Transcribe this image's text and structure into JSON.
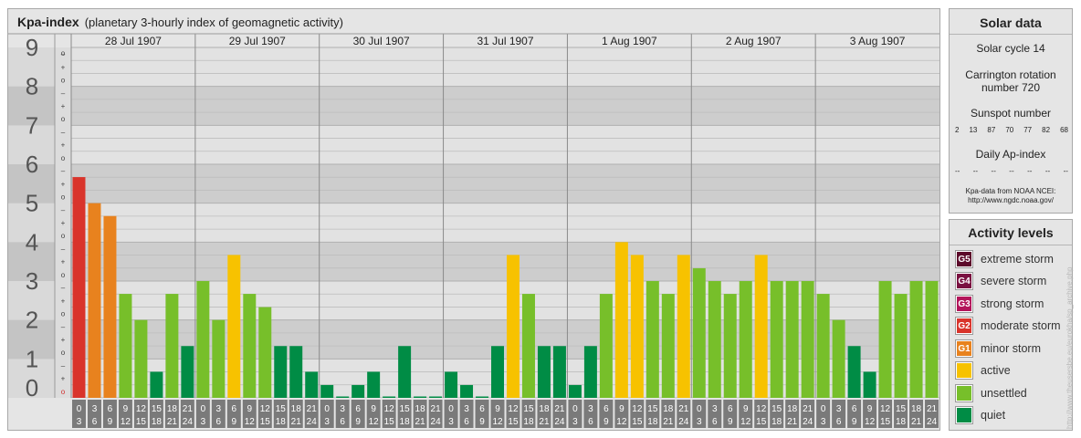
{
  "header": {
    "title": "Kpa-index",
    "subtitle": "(planetary 3-hourly index of geomagnetic activity)"
  },
  "chart_data": {
    "type": "bar",
    "title": "Kpa-index",
    "subtitle": "(planetary 3-hourly index of geomagnetic activity)",
    "ylim": [
      0,
      9
    ],
    "y_ticks": [
      "0",
      "1",
      "2",
      "3",
      "4",
      "5",
      "6",
      "7",
      "8",
      "9"
    ],
    "y_subticks": [
      "o",
      "+",
      "–"
    ],
    "days": [
      "28 Jul 1907",
      "29 Jul 1907",
      "30 Jul 1907",
      "31 Jul 1907",
      "1 Aug 1907",
      "2 Aug 1907",
      "3 Aug 1907"
    ],
    "interval_starts": [
      "0",
      "3",
      "6",
      "9",
      "12",
      "15",
      "18",
      "21"
    ],
    "interval_ends": [
      "3",
      "6",
      "9",
      "12",
      "15",
      "18",
      "21",
      "24"
    ],
    "values": [
      5.67,
      5.0,
      4.67,
      2.67,
      2.0,
      0.67,
      2.67,
      1.33,
      3.0,
      2.0,
      3.67,
      2.67,
      2.33,
      1.33,
      1.33,
      0.67,
      0.33,
      0.0,
      0.33,
      0.67,
      0.0,
      1.33,
      0.0,
      0.0,
      0.67,
      0.33,
      0.0,
      1.33,
      3.67,
      2.67,
      1.33,
      1.33,
      0.33,
      1.33,
      2.67,
      4.0,
      3.67,
      3.0,
      2.67,
      3.67,
      3.33,
      3.0,
      2.67,
      3.0,
      3.67,
      3.0,
      3.0,
      3.0,
      2.67,
      2.0,
      1.33,
      0.67,
      3.0,
      2.67,
      3.0,
      3.0
    ],
    "colors": {
      "G5": "#5c0a2a",
      "G4": "#7a1040",
      "G3": "#b3145a",
      "G2": "#d9342b",
      "G1": "#e8821e",
      "active": "#f7c200",
      "unsettled": "#77bf2a",
      "quiet": "#008c45"
    },
    "grid": true
  },
  "solar": {
    "title": "Solar data",
    "cycle": "Solar cycle 14",
    "carrington_line1": "Carrington rotation",
    "carrington_line2": "number 720",
    "sunspot_label": "Sunspot number",
    "sunspot_numbers": [
      "2",
      "13",
      "87",
      "70",
      "77",
      "82",
      "68"
    ],
    "ap_label": "Daily Ap-index",
    "ap_values": [
      "--",
      "--",
      "--",
      "--",
      "--",
      "--",
      "--"
    ],
    "source_line1": "Kpa-data from NOAA NCEI:",
    "source_line2": "http://www.ngdc.noaa.gov/"
  },
  "levels": {
    "title": "Activity levels",
    "items": [
      {
        "badge": "G5",
        "label": "extreme storm",
        "color": "#5c0a2a"
      },
      {
        "badge": "G4",
        "label": "severe storm",
        "color": "#7a1040"
      },
      {
        "badge": "G3",
        "label": "strong storm",
        "color": "#b3145a"
      },
      {
        "badge": "G2",
        "label": "moderate storm",
        "color": "#d9342b"
      },
      {
        "badge": "G1",
        "label": "minor storm",
        "color": "#e8821e"
      },
      {
        "badge": "",
        "label": "active",
        "color": "#f7c200"
      },
      {
        "badge": "",
        "label": "unsettled",
        "color": "#77bf2a"
      },
      {
        "badge": "",
        "label": "quiet",
        "color": "#008c45"
      }
    ]
  },
  "credit": "http://www.theusersbe.eu/eurokha/sp_archive.php"
}
